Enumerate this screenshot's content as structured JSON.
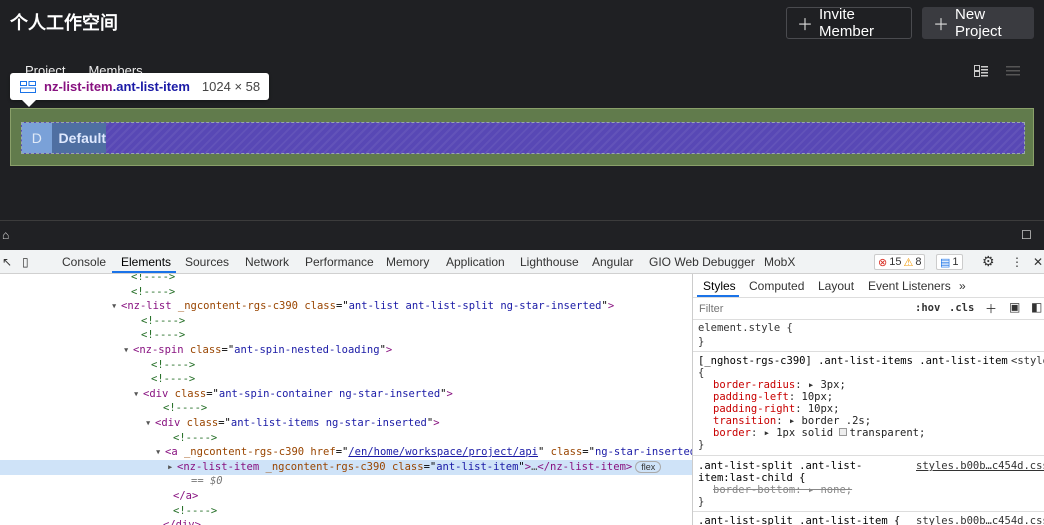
{
  "app": {
    "title": "个人工作空间",
    "invite_label": "Invite Member",
    "new_project_label": "New Project",
    "tabs": [
      "Project",
      "Members"
    ],
    "list_item": {
      "avatar_letter": "D",
      "label": "Default"
    }
  },
  "tooltip": {
    "tag": "nz-list-item",
    "classes": ".ant-list-item",
    "size": "1024 × 58"
  },
  "devtools": {
    "tabs": [
      "Console",
      "Elements",
      "Sources",
      "Network",
      "Performance",
      "Memory",
      "Application",
      "Lighthouse",
      "Angular",
      "GIO Web Debugger",
      "MobX"
    ],
    "active_tab": "Elements",
    "errors": "15",
    "warnings": "8",
    "messages": "1",
    "styles_tabs": [
      "Styles",
      "Computed",
      "Layout",
      "Event Listeners",
      "»"
    ],
    "filter_placeholder": "Filter",
    "hov": ":hov",
    "cls": ".cls",
    "dom_lines": [
      {
        "t": "<!---->"
      },
      {
        "t": "<!---->"
      },
      {
        "tag_open": "<nz-list",
        "attrs": [
          [
            "_ngcontent-rgs-c390",
            ""
          ],
          [
            "class",
            "ant-list ant-list-split ng-star-inserted"
          ]
        ],
        "close": ">"
      },
      {
        "t": "<!---->"
      },
      {
        "t": "<!---->"
      },
      {
        "tag_open": "<nz-spin",
        "attrs": [
          [
            "class",
            "ant-spin-nested-loading"
          ]
        ],
        "close": ">"
      },
      {
        "t": "<!---->"
      },
      {
        "t": "<!---->"
      },
      {
        "tag_open": "<div",
        "attrs": [
          [
            "class",
            "ant-spin-container ng-star-inserted"
          ]
        ],
        "close": ">"
      },
      {
        "t": "<!---->"
      },
      {
        "tag_open": "<div",
        "attrs": [
          [
            "class",
            "ant-list-items ng-star-inserted"
          ]
        ],
        "close": ">"
      },
      {
        "t": "<!---->"
      },
      {
        "tag_open": "<a",
        "attrs": [
          [
            "_ngcontent-rgs-c390",
            ""
          ],
          [
            "href",
            "/en/home/workspace/project/api"
          ],
          [
            "class",
            "ng-star-inserted"
          ]
        ],
        "close": ">"
      },
      {
        "tag_open": "<nz-list-item",
        "attrs": [
          [
            "_ngcontent-rgs-c390",
            ""
          ],
          [
            "class",
            "ant-list-item"
          ]
        ],
        "close": ">",
        "tail": "</nz-list-item>",
        "badge": "flex"
      },
      {
        "t": "== $0"
      },
      {
        "tag_open": "</a>"
      },
      {
        "t": "<!---->"
      },
      {
        "tag_open": "</div>"
      }
    ],
    "rules": {
      "element_style": "element.style {",
      "close": "}",
      "rule1_selector": "[_nghost-rgs-c390] .ant-list-items .ant-list-item",
      "rule1_src": "<style",
      "rule1_props": [
        [
          "border-radius",
          "3px;"
        ],
        [
          "padding-left",
          "10px;"
        ],
        [
          "padding-right",
          "10px;"
        ],
        [
          "transition",
          "border .2s;"
        ],
        [
          "border",
          "1px solid ",
          "transparent;"
        ]
      ],
      "rule2_selector_a": ".ant-list-split .ant-list-",
      "rule2_selector_b": "item:last-child {",
      "rule2_src": "styles.b00b…c454d.css:",
      "rule2_prop": [
        "border-bottom",
        "none;"
      ],
      "rule3_selector": ".ant-list-split .ant-list-item {",
      "rule3_src": "styles.b00b…c454d.css:"
    }
  }
}
